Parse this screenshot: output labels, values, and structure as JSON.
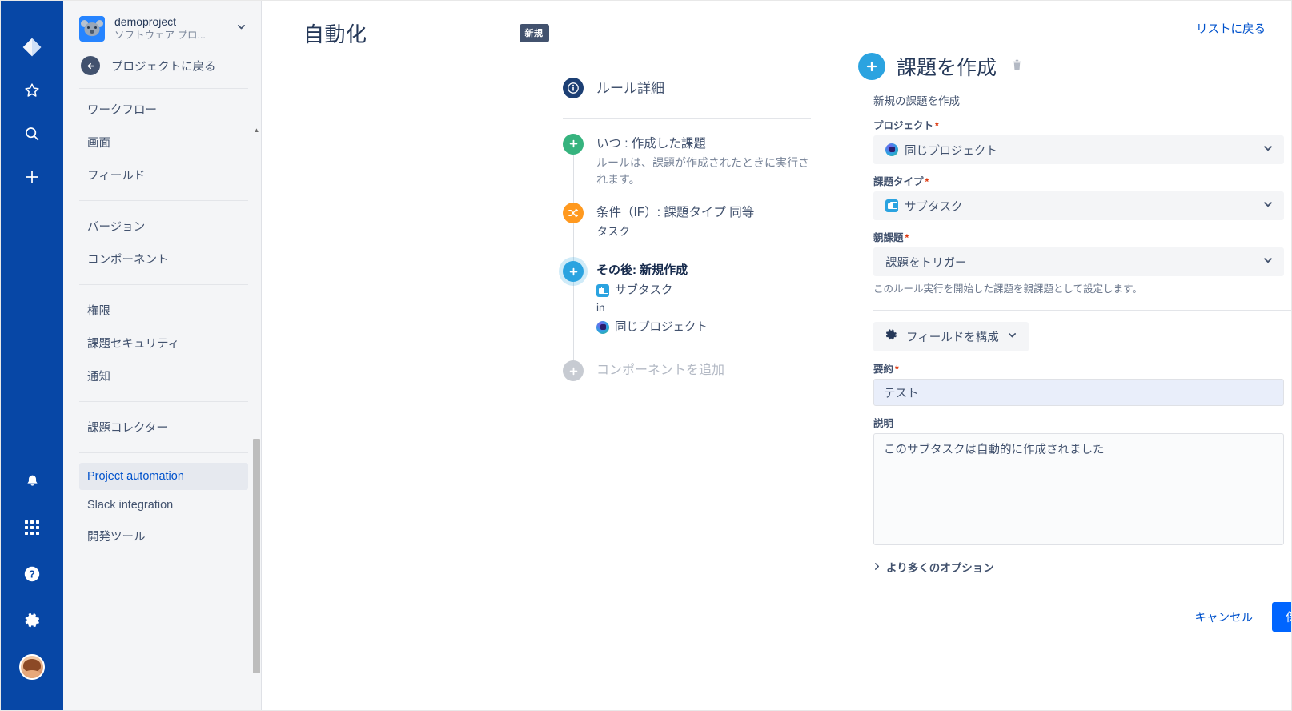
{
  "rail": {
    "top_icons": [
      {
        "name": "jira-logo-icon",
        "label": "Jira"
      },
      {
        "name": "star-icon",
        "label": "Starred"
      },
      {
        "name": "search-icon",
        "label": "Search"
      },
      {
        "name": "plus-icon",
        "label": "Create"
      }
    ],
    "bottom_icons": [
      {
        "name": "bell-icon",
        "label": "Notifications"
      },
      {
        "name": "apps-grid-icon",
        "label": "Apps"
      },
      {
        "name": "help-icon",
        "label": "Help"
      },
      {
        "name": "gear-icon",
        "label": "Settings"
      },
      {
        "name": "avatar",
        "label": "Profile"
      }
    ]
  },
  "sidebar": {
    "project_name": "demoproject",
    "project_type": "ソフトウェア プロ...",
    "back_label": "プロジェクトに戻る",
    "groups": [
      {
        "items": [
          {
            "label": "ワークフロー",
            "active": false
          },
          {
            "label": "画面",
            "active": false
          },
          {
            "label": "フィールド",
            "active": false
          }
        ]
      },
      {
        "items": [
          {
            "label": "バージョン",
            "active": false
          },
          {
            "label": "コンポーネント",
            "active": false
          }
        ]
      },
      {
        "items": [
          {
            "label": "権限",
            "active": false
          },
          {
            "label": "課題セキュリティ",
            "active": false
          },
          {
            "label": "通知",
            "active": false
          }
        ]
      },
      {
        "items": [
          {
            "label": "課題コレクター",
            "active": false
          }
        ]
      },
      {
        "items": [
          {
            "label": "Project automation",
            "active": true
          },
          {
            "label": "Slack integration",
            "active": false
          },
          {
            "label": "開発ツール",
            "active": false
          }
        ]
      }
    ]
  },
  "header": {
    "title": "自動化",
    "badge": "新規",
    "back_to_list": "リストに戻る"
  },
  "rule_tree": {
    "detail_label": "ルール詳細",
    "nodes": [
      {
        "bullet": "green",
        "icon_name": "plus-circle-icon",
        "title": "いつ : 作成した課題",
        "subtitle": "ルールは、課題が作成されたときに実行されます。",
        "selected": false
      },
      {
        "bullet": "orange",
        "icon_name": "shuffle-icon",
        "title": "条件（IF）: 課題タイプ 同等",
        "subtitle": "タスク",
        "selected": false
      },
      {
        "bullet": "blue",
        "icon_name": "plus-circle-icon",
        "title": "その後: 新規作成",
        "issue_type": "サブタスク",
        "in_word": "in",
        "project": "同じプロジェクト",
        "selected": true
      }
    ],
    "add_component": "コンポーネントを追加"
  },
  "form": {
    "title": "課題を作成",
    "subtitle": "新規の課題を作成",
    "delete_icon": "trash-icon",
    "fields": {
      "project": {
        "label": "プロジェクト",
        "required": true,
        "value": "同じプロジェクト",
        "icon": "project-avatar-icon"
      },
      "issue_type": {
        "label": "課題タイプ",
        "required": true,
        "value": "サブタスク",
        "icon": "subtask-icon"
      },
      "parent_issue": {
        "label": "親課題",
        "required": true,
        "value": "課題をトリガー",
        "hint": "このルール実行を開始した課題を親課題として設定します。"
      },
      "summary": {
        "label": "要約",
        "required": true,
        "value": "テスト",
        "placeholder": ""
      },
      "description": {
        "label": "説明",
        "required": false,
        "value": "このサブタスクは自動的に作成されました",
        "placeholder": ""
      }
    },
    "configure_fields_label": "フィールドを構成",
    "more_options_label": "より多くのオプション",
    "cancel_label": "キャンセル",
    "save_label": "保存"
  },
  "colors": {
    "rail_bg": "#0747A6",
    "sidebar_bg": "#f4f5f7",
    "accent_blue": "#0052CC",
    "save_blue": "#0065FF",
    "green": "#36B37E",
    "orange": "#FF991F",
    "light_blue": "#2BA3E0"
  }
}
